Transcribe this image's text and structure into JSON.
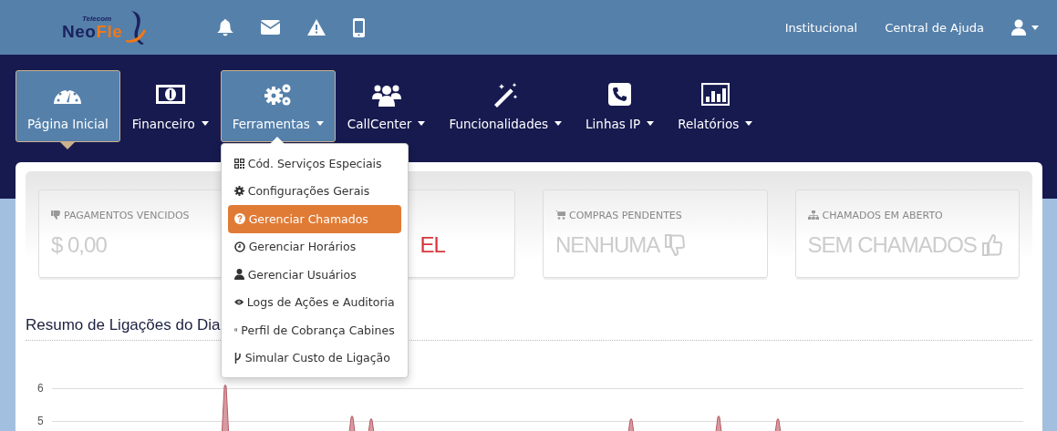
{
  "header": {
    "logo": {
      "tagline": "Telecom",
      "word": "Neo",
      "accent": "Fle"
    },
    "links": [
      {
        "label": "Institucional"
      },
      {
        "label": "Central de Ajuda"
      }
    ]
  },
  "nav": [
    {
      "label": "Página Inicial",
      "dropdown": false,
      "selected": true,
      "open": false
    },
    {
      "label": "Financeiro",
      "dropdown": true,
      "selected": false,
      "open": false
    },
    {
      "label": "Ferramentas",
      "dropdown": true,
      "selected": false,
      "open": true
    },
    {
      "label": "CallCenter",
      "dropdown": true,
      "selected": false,
      "open": false
    },
    {
      "label": "Funcionalidades",
      "dropdown": true,
      "selected": false,
      "open": false
    },
    {
      "label": "Linhas IP",
      "dropdown": true,
      "selected": false,
      "open": false
    },
    {
      "label": "Relatórios",
      "dropdown": true,
      "selected": false,
      "open": false
    }
  ],
  "tools_menu": [
    {
      "label": "Cód. Serviços Especiais",
      "selected": false
    },
    {
      "label": "Configurações Gerais",
      "selected": false
    },
    {
      "label": "Gerenciar Chamados",
      "selected": true
    },
    {
      "label": "Gerenciar Horários",
      "selected": false
    },
    {
      "label": "Gerenciar Usuários",
      "selected": false
    },
    {
      "label": "Logs de Ações e Auditoria",
      "selected": false
    },
    {
      "label": "Perfil de Cobrança Cabines",
      "selected": false
    },
    {
      "label": "Simular Custo de Ligação",
      "selected": false
    }
  ],
  "stats": [
    {
      "title": "PAGAMENTOS VENCIDOS",
      "value": "$ 0,00",
      "alert": false
    },
    {
      "value": "EL",
      "alert": true
    },
    {
      "title": "COMPRAS PENDENTES",
      "value": "NENHUMA",
      "alert": false
    },
    {
      "title": "CHAMADOS EM ABERTO",
      "value": "SEM CHAMADOS",
      "alert": false
    }
  ],
  "calls_chart": {
    "title": "Resumo de Ligações do Dia",
    "y_labels": [
      "6",
      "5"
    ]
  }
}
